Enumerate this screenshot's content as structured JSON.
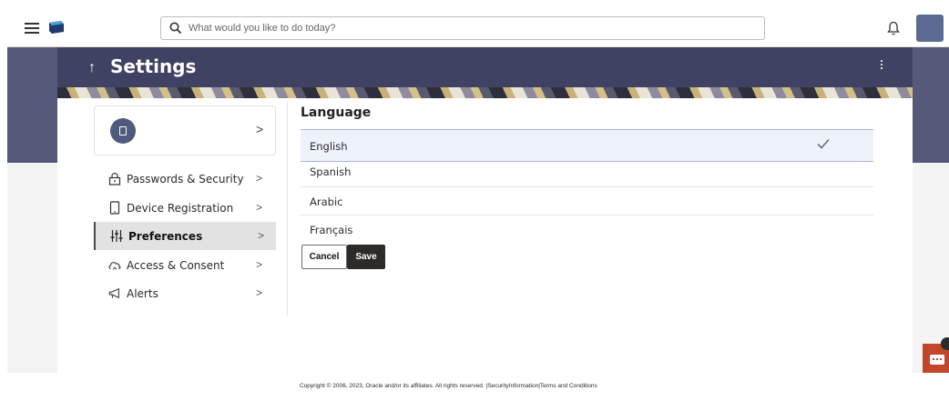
{
  "header": {
    "search_placeholder": "What would you like to do today?"
  },
  "page": {
    "title": "Settings",
    "back_glyph": "↑"
  },
  "sidebar": {
    "profile_chevron": ">",
    "items": [
      {
        "label": "Passwords & Security",
        "icon": "lock-icon",
        "active": false
      },
      {
        "label": "Device Registration",
        "icon": "mobile-device-icon",
        "active": false
      },
      {
        "label": "Preferences",
        "icon": "sliders-icon",
        "active": true
      },
      {
        "label": "Access & Consent",
        "icon": "cloud-access-icon",
        "active": false
      },
      {
        "label": "Alerts",
        "icon": "megaphone-icon",
        "active": false
      }
    ],
    "chevron": ">"
  },
  "language": {
    "title": "Language",
    "options": [
      "English",
      "Spanish",
      "Arabic",
      "Français"
    ],
    "selected": "English"
  },
  "buttons": {
    "cancel": "Cancel",
    "save": "Save"
  },
  "footer": {
    "copyright": "Copyright © 2006, 2023, Oracle and/or its affiliates. All rights reserved.",
    "separator": "|",
    "security_link": "SecurityInformation",
    "terms_link": "Terms and Conditions"
  },
  "colors": {
    "banner": "#3f4262",
    "accent": "#4f5a7c",
    "save_button": "#2d2a28",
    "chat_button": "#c2462a"
  }
}
